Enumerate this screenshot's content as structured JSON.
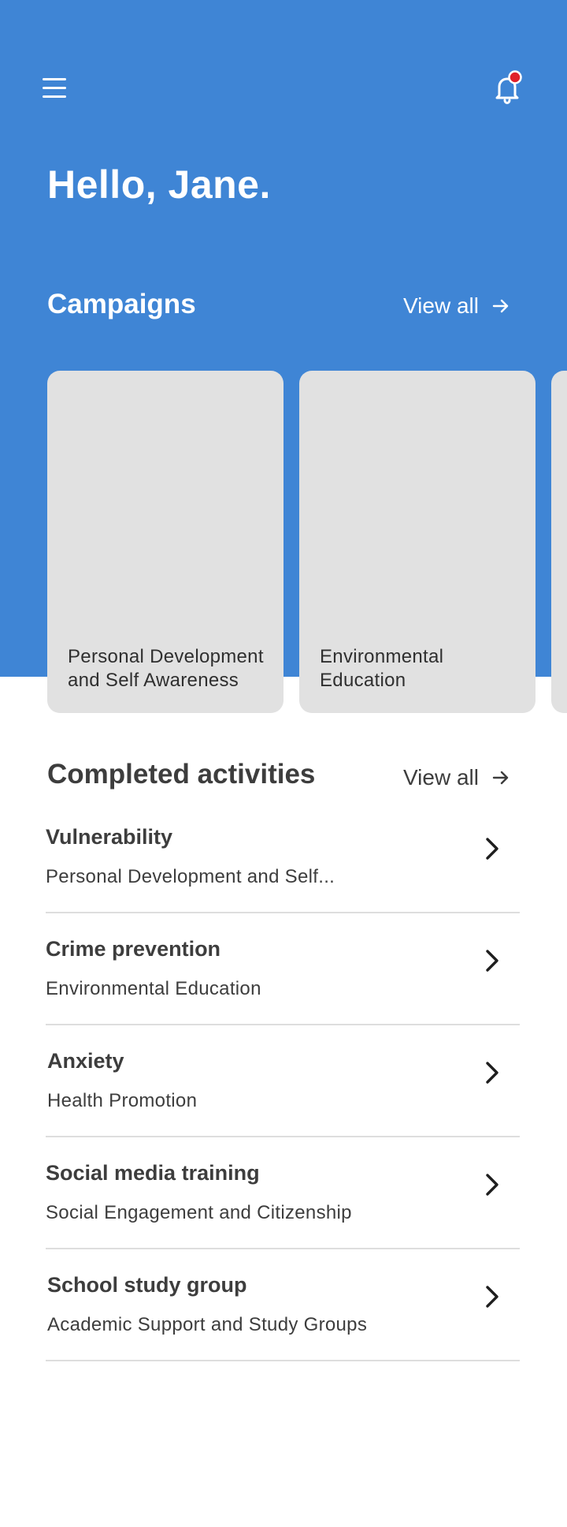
{
  "header": {
    "menu_icon": "hamburger-menu-icon",
    "bell_icon": "bell-icon",
    "notification_dot_color": "#e0202a",
    "greeting": "Hello, Jane."
  },
  "colors": {
    "primary": "#3f85d5",
    "card_bg": "#e1e1e1",
    "text": "#3d3d3d"
  },
  "campaigns": {
    "title": "Campaigns",
    "view_all": "View all",
    "items": [
      {
        "label": "Personal Development and Self Awareness"
      },
      {
        "label": "Environmental Education"
      },
      {
        "label": ""
      }
    ]
  },
  "completed": {
    "title": "Completed activities",
    "view_all": "View all",
    "items": [
      {
        "title": "Vulnerability",
        "subtitle": "Personal Development and Self..."
      },
      {
        "title": "Crime prevention",
        "subtitle": "Environmental Education"
      },
      {
        "title": "Anxiety",
        "subtitle": "Health Promotion"
      },
      {
        "title": "Social media training",
        "subtitle": "Social Engagement and Citizenship"
      },
      {
        "title": "School study group",
        "subtitle": "Academic Support and Study Groups"
      }
    ]
  }
}
